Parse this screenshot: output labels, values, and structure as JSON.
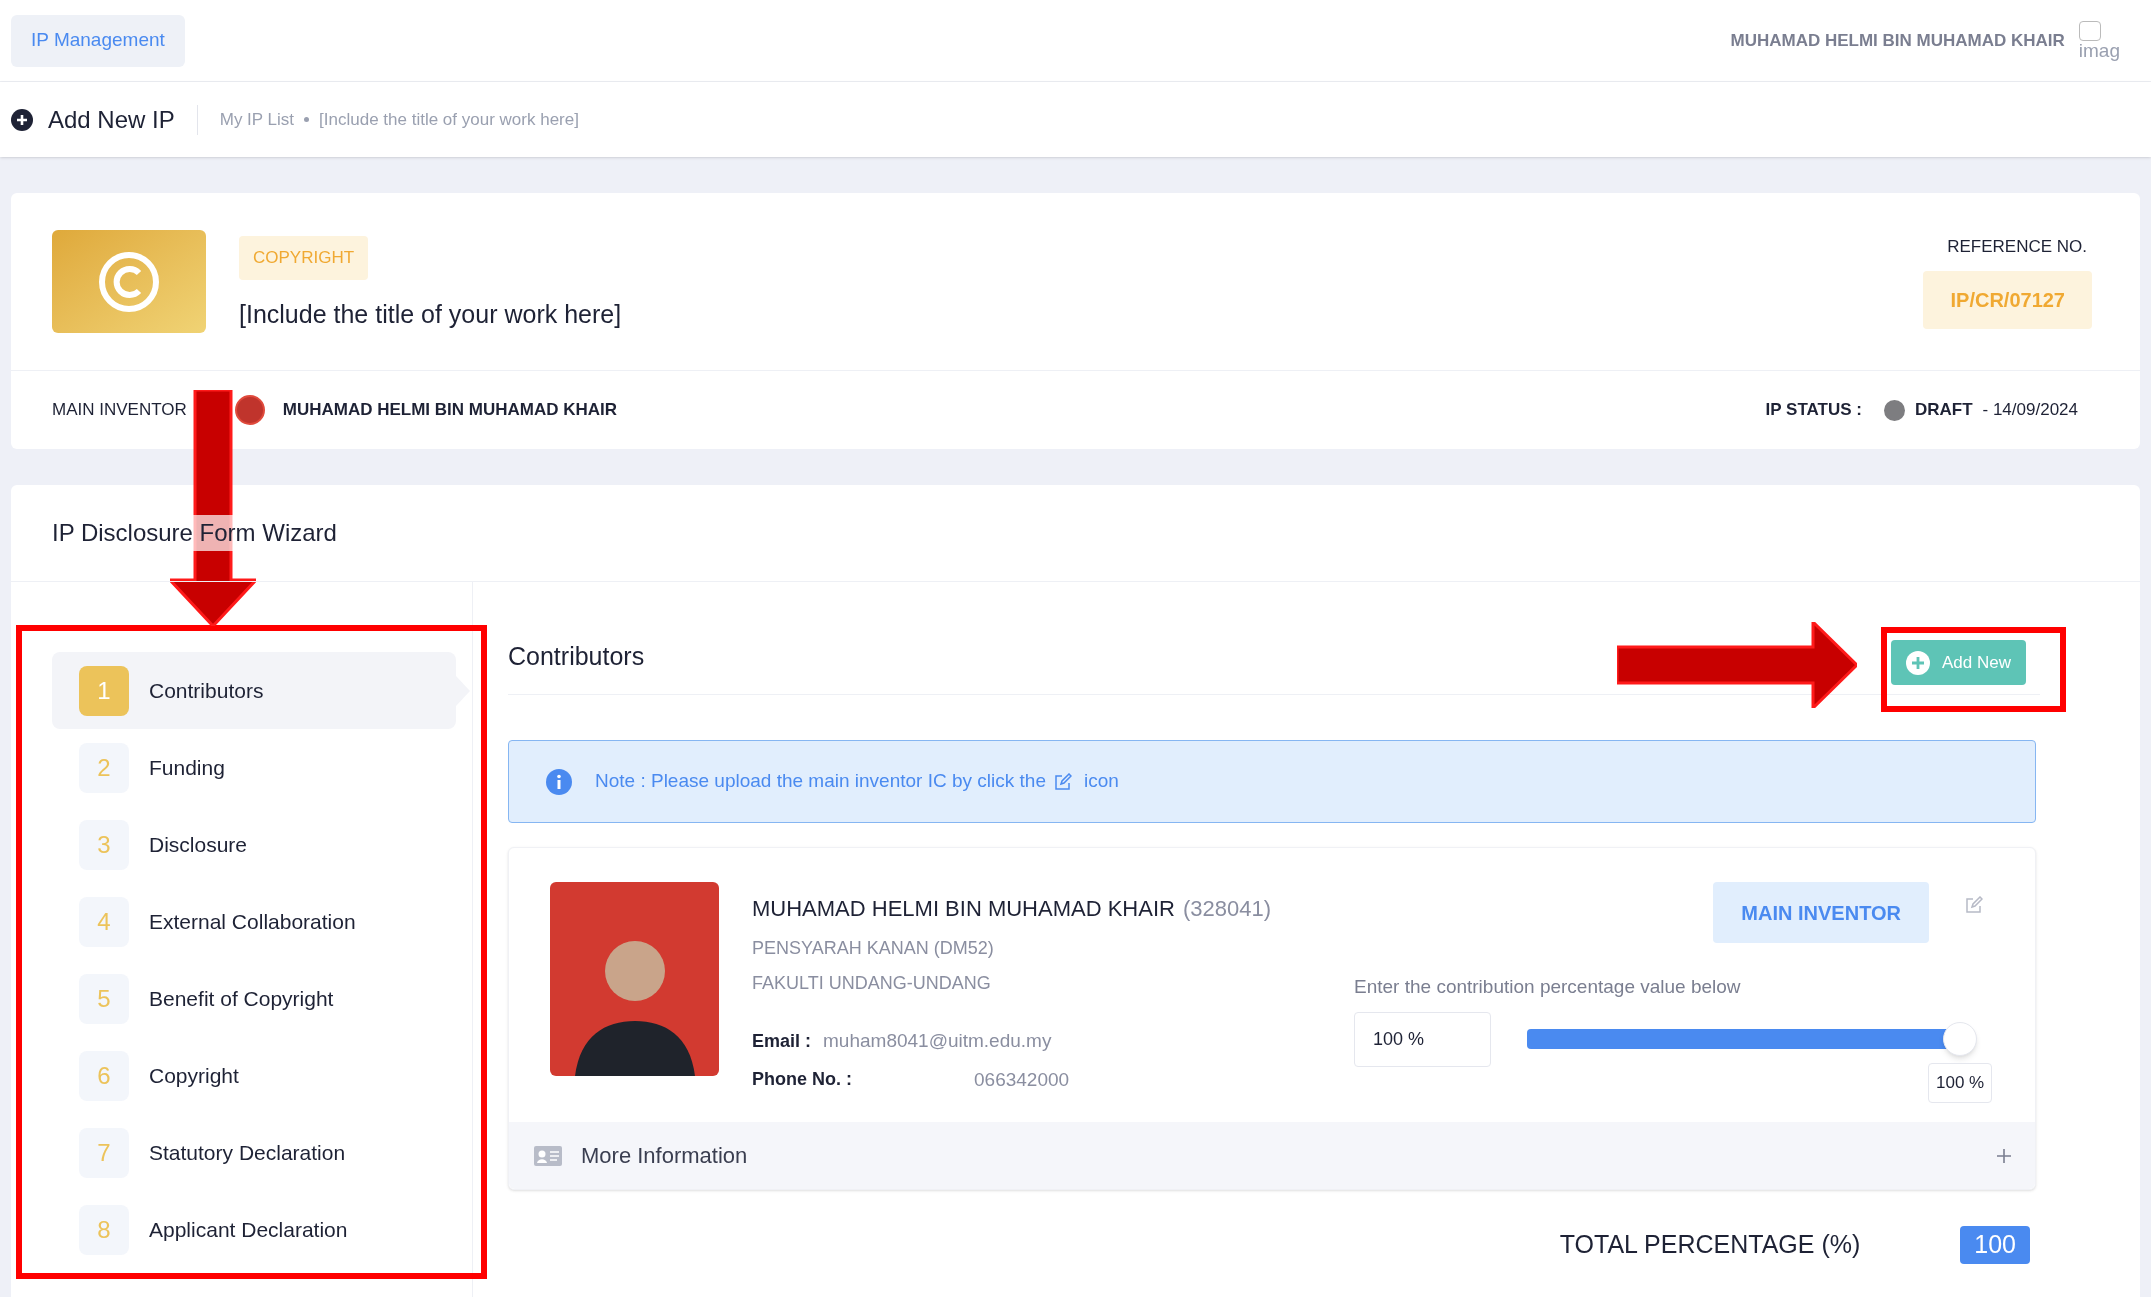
{
  "top_bar": {
    "app_button": "IP Management",
    "user_name": "MUHAMAD HELMI BIN MUHAMAD KHAIR",
    "avatar_alt_text": "imag"
  },
  "breadcrumb": {
    "page_title": "Add New IP",
    "items": [
      "My IP List",
      "[Include the title of your work here]"
    ]
  },
  "ip_header": {
    "type_badge": "COPYRIGHT",
    "title": "[Include the title of your work here]",
    "reference_label": "REFERENCE NO.",
    "reference_no": "IP/CR/07127",
    "main_inventor_label": "MAIN INVENTOR",
    "main_inventor_name": "MUHAMAD HELMI BIN MUHAMAD KHAIR",
    "status_label": "IP STATUS :",
    "status": "DRAFT",
    "status_date": "- 14/09/2024"
  },
  "wizard": {
    "title": "IP Disclosure Form Wizard",
    "steps": [
      {
        "number": "1",
        "label": "Contributors",
        "selected": true
      },
      {
        "number": "2",
        "label": "Funding",
        "selected": false
      },
      {
        "number": "3",
        "label": "Disclosure",
        "selected": false
      },
      {
        "number": "4",
        "label": "External Collaboration",
        "selected": false
      },
      {
        "number": "5",
        "label": "Benefit of Copyright",
        "selected": false
      },
      {
        "number": "6",
        "label": "Copyright",
        "selected": false
      },
      {
        "number": "7",
        "label": "Statutory Declaration",
        "selected": false
      },
      {
        "number": "8",
        "label": "Applicant Declaration",
        "selected": false
      }
    ]
  },
  "contributors": {
    "heading": "Contributors",
    "add_button": "Add New",
    "note": "Note : Please upload the main inventor IC by click the",
    "note_suffix": "icon",
    "list": [
      {
        "name": "MUHAMAD HELMI BIN MUHAMAD KHAIR",
        "staff_id": "(328041)",
        "position": "PENSYARAH KANAN (DM52)",
        "faculty": "FAKULTI UNDANG-UNDANG",
        "email_label": "Email :",
        "email": "muham8041@uitm.edu.my",
        "phone_label": "Phone No. :",
        "phone": "066342000",
        "role_badge": "MAIN INVENTOR",
        "percentage_prompt": "Enter the contribution percentage value below",
        "percentage_value": "100 %",
        "level": 1,
        "level_reading": "100 %",
        "more_info": "More Information"
      }
    ],
    "total_label": "TOTAL PERCENTAGE (%)",
    "total_value": "100"
  }
}
